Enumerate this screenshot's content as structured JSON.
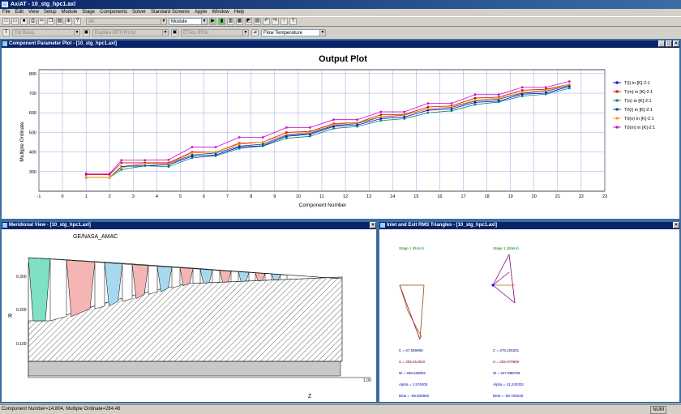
{
  "app": {
    "title": "AxiAT - 10_stg_hpc1.axl"
  },
  "menu": [
    "File",
    "Edit",
    "View",
    "Setup",
    "Module",
    "Stage",
    "Components",
    "Solver",
    "Standard Screens",
    "Apple",
    "Window",
    "Help"
  ],
  "toolbar": {
    "combo_all": "All",
    "combo_module": "Module",
    "combo_txt": "Txt Basic",
    "combo_explore": "Explore  MTrl  Flt  for",
    "combo_etats": "ETAts  PFlts",
    "combo_flow": "Flow  Temperature"
  },
  "plot_window": {
    "title": "Component Parameter Plot - [10_stg_hpc1.axl]",
    "heading": "Output Plot",
    "xlabel": "Component Number",
    "ylabel": "Multiple Ordinate",
    "chart_data": {
      "type": "line",
      "title": "Output Plot",
      "xlabel": "Component Number",
      "ylabel": "Multiple Ordinate",
      "xlim": [
        -1,
        23
      ],
      "ylim": [
        200,
        820
      ],
      "xticks": [
        "-1",
        "0",
        "1",
        "2",
        "3",
        "4",
        "5",
        "6",
        "7",
        "8",
        "9",
        "10",
        "11",
        "12",
        "13",
        "14",
        "15",
        "16",
        "17",
        "18",
        "19",
        "20",
        "21",
        "22",
        "23"
      ],
      "yticks": [
        "300",
        "400",
        "500",
        "600",
        "700",
        "800"
      ],
      "grid": true,
      "legend": "right",
      "x": [
        1,
        2,
        2.5,
        3.5,
        4.5,
        5.5,
        6.5,
        7.5,
        8.5,
        9.5,
        10.5,
        11.5,
        12.5,
        13.5,
        14.5,
        15.5,
        16.5,
        17.5,
        18.5,
        19.5,
        20.5,
        21.5
      ],
      "series": [
        {
          "name": "T(i) in [K]-2:1",
          "color": "#0000cc",
          "values": [
            270,
            270,
            325,
            330,
            335,
            378,
            385,
            425,
            432,
            480,
            490,
            530,
            538,
            570,
            578,
            613,
            620,
            653,
            660,
            695,
            700,
            735
          ]
        },
        {
          "name": "T(m) in [K]-2:1",
          "color": "#dd0000",
          "values": [
            285,
            285,
            345,
            345,
            345,
            400,
            400,
            445,
            450,
            500,
            505,
            545,
            550,
            590,
            592,
            630,
            635,
            675,
            680,
            715,
            720,
            745
          ]
        },
        {
          "name": "T(o) in [K]-2:1",
          "color": "#008080",
          "values": [
            270,
            270,
            310,
            330,
            325,
            370,
            380,
            418,
            430,
            470,
            480,
            520,
            530,
            560,
            570,
            600,
            610,
            642,
            655,
            685,
            695,
            725
          ]
        },
        {
          "name": "T0(i) in [K]-2:1",
          "color": "#004488",
          "values": [
            270,
            270,
            325,
            340,
            340,
            385,
            395,
            430,
            440,
            485,
            495,
            535,
            545,
            578,
            588,
            620,
            628,
            660,
            670,
            700,
            710,
            740
          ]
        },
        {
          "name": "T0(o) in [K]-2:1",
          "color": "#ff9900",
          "values": [
            270,
            270,
            320,
            340,
            340,
            395,
            400,
            440,
            450,
            490,
            500,
            540,
            550,
            580,
            590,
            620,
            630,
            665,
            675,
            705,
            715,
            745
          ]
        },
        {
          "name": "T0(m) in [K]-2:1",
          "color": "#cc00cc",
          "values": [
            290,
            290,
            358,
            358,
            360,
            425,
            425,
            475,
            475,
            525,
            525,
            565,
            565,
            605,
            605,
            648,
            648,
            693,
            693,
            730,
            730,
            760
          ]
        }
      ]
    }
  },
  "meridional_window": {
    "title": "Meridional View - [10_stg_hpc1.axl]",
    "label": "GE/NASA_AMAC",
    "y_axis": "R",
    "x_axis": "Z",
    "ticks": [
      "0.300",
      "0.200",
      "0.100"
    ],
    "z_tick": "1.00"
  },
  "triangles_window": {
    "title": "Inlet and Exit RMS Triangles - [10_stg_hpc1.axl]",
    "left": {
      "header": "Stage 1 (Rotor)",
      "C": "C = 67.559908",
      "U": "U = 265.914920",
      "W": "W = 266.639091",
      "alpha": "Alpha = 1.576300",
      "beta": "Beta = -69.809992"
    },
    "right": {
      "header": "Stage 1 (Stator)",
      "C": "C = 276.226301",
      "U": "U = 265.979908",
      "W": "W = 247.988798",
      "alpha": "Alpha = 41.240302",
      "beta": "Beta = -58.709249"
    }
  },
  "status": {
    "text": "Component Number=14.804, Multiple Ordinate=284.46",
    "nav": "NUM"
  }
}
